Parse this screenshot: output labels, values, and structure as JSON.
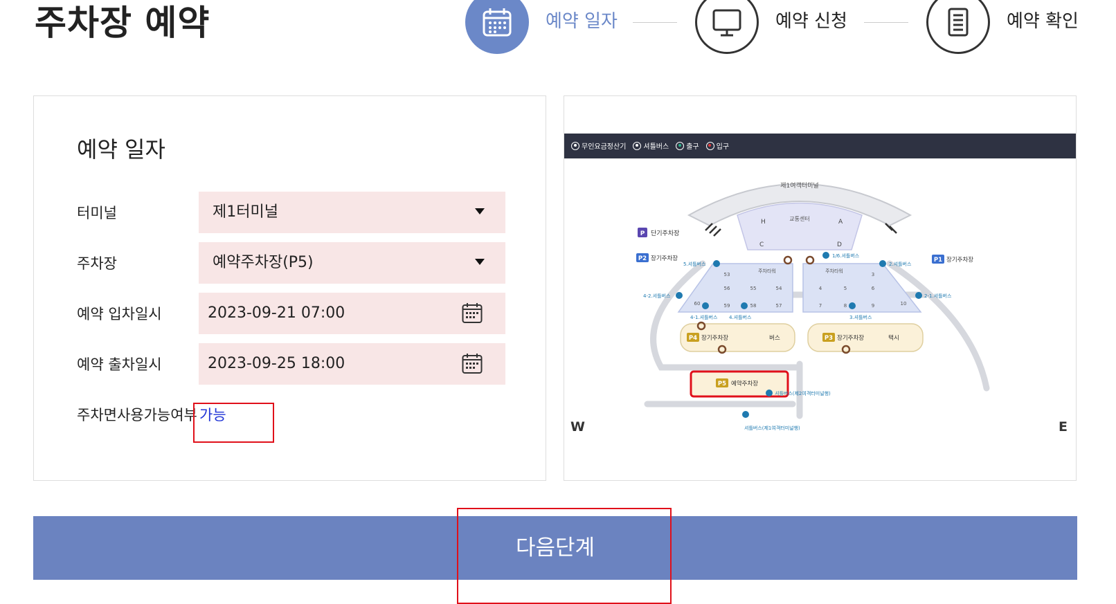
{
  "page": {
    "title": "주차장 예약"
  },
  "steps": [
    {
      "label": "예약 일자",
      "state": "active",
      "icon": "calendar-icon"
    },
    {
      "label": "예약 신청",
      "state": "inactive",
      "icon": "monitor-icon"
    },
    {
      "label": "예약 확인",
      "state": "inactive",
      "icon": "document-icon"
    }
  ],
  "form": {
    "title": "예약 일자",
    "terminal_label": "터미널",
    "terminal_value": "제1터미널",
    "parking_label": "주차장",
    "parking_value": "예약주차장(P5)",
    "entry_label": "예약 입차일시",
    "entry_value": "2023-09-21 07:00",
    "exit_label": "예약 출차일시",
    "exit_value": "2023-09-25 18:00",
    "availability_label": "주차면사용가능여부",
    "availability_value": "가능"
  },
  "map": {
    "legend": [
      {
        "label": "무인요금정산기",
        "icon": "kiosk-icon"
      },
      {
        "label": "셔틀버스",
        "icon": "bus-icon"
      },
      {
        "label": "출구",
        "icon": "exit-icon"
      },
      {
        "label": "입구",
        "icon": "entrance-icon"
      }
    ],
    "terminal_label": "제1여객터미널",
    "traffic_center_label": "교통센터",
    "zone_labels": {
      "h": "H",
      "a": "A",
      "c": "C",
      "d": "D"
    },
    "short_term": {
      "code": "P",
      "label": "단기주차장"
    },
    "p1": {
      "code": "P1",
      "label": "장기주차장"
    },
    "p2": {
      "code": "P2",
      "label": "장기주차장"
    },
    "p3": {
      "code": "P3",
      "label": "장기주차장",
      "extra": "택시"
    },
    "p4": {
      "code": "P4",
      "label": "장기주차장",
      "extra": "버스"
    },
    "p5": {
      "code": "P5",
      "label": "예약주차장"
    },
    "tower_label": "주차타워",
    "west_blocks": [
      "53",
      "56",
      "55",
      "54",
      "59",
      "58",
      "57"
    ],
    "west_extra": "60",
    "east_blocks": [
      "3",
      "4",
      "5",
      "6",
      "7",
      "8",
      "9",
      "10"
    ],
    "shuttles": {
      "s5": "5.셔틀버스",
      "s16": "1/6.셔틀버스",
      "s2": "2.셔틀버스",
      "s42": "4-2.셔틀버스",
      "s21": "2-1.셔틀버스",
      "s41": "4-1.셔틀버스",
      "s4": "4.셔틀버스",
      "s3": "3.셔틀버스",
      "t2": "셔틀버스(제2여객터미널행)",
      "t1": "셔틀버스(제1여객터미널행)"
    },
    "west": "W",
    "east": "E"
  },
  "next_button": {
    "label": "다음단계"
  },
  "colors": {
    "accent": "#6b88c8",
    "field_bg": "#f8e6e6",
    "highlight": "#e0101a",
    "available": "#1f33d6"
  }
}
